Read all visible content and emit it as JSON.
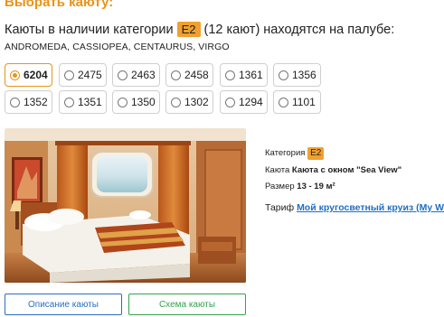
{
  "header": {
    "title": "Выбрать каюту:",
    "avail_prefix": "Каюты в наличии категории",
    "category_badge": "E2",
    "avail_suffix": "(12 кают) находятся на палубе:",
    "decks": "ANDROMEDA, CASSIOPEA, CENTAURUS, VIRGO"
  },
  "cabins": [
    {
      "number": "6204",
      "selected": true
    },
    {
      "number": "2475",
      "selected": false
    },
    {
      "number": "2463",
      "selected": false
    },
    {
      "number": "2458",
      "selected": false
    },
    {
      "number": "1361",
      "selected": false
    },
    {
      "number": "1356",
      "selected": false
    },
    {
      "number": "1352",
      "selected": false
    },
    {
      "number": "1351",
      "selected": false
    },
    {
      "number": "1350",
      "selected": false
    },
    {
      "number": "1302",
      "selected": false
    },
    {
      "number": "1294",
      "selected": false
    },
    {
      "number": "1101",
      "selected": false
    }
  ],
  "info": {
    "category_label": "Категория",
    "category_value": "E2",
    "type_label": "Каюта",
    "type_value": "Каюта с окном \"Sea View\"",
    "size_label": "Размер",
    "size_value": "13 - 19 м²",
    "tariff_label": "Тариф",
    "tariff_value": "Мой кругосветный круиз (My Wo"
  },
  "buttons": {
    "description": "Описание каюты",
    "scheme": "Схема каюты"
  },
  "colors": {
    "accent": "#e8931a",
    "link": "#1e6fc4",
    "scheme_green": "#34a34a"
  }
}
